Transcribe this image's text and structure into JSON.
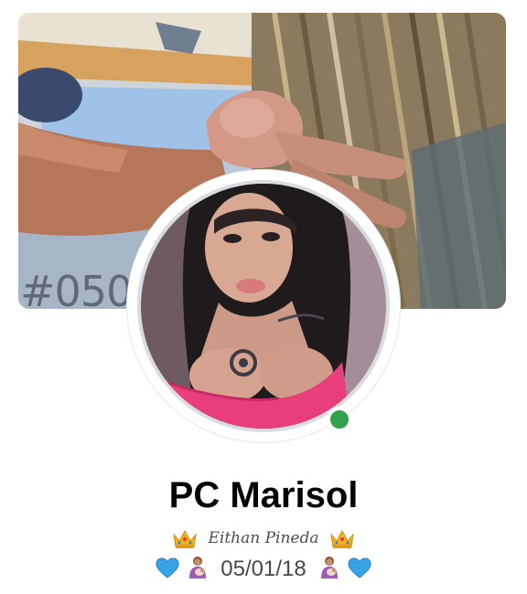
{
  "profile": {
    "cover_watermark": "#050",
    "name": "PC Marisol",
    "online": true,
    "status_color": "#31a24c"
  },
  "bio": {
    "line1_text": "Eithan Pineda",
    "line1_emoji": "crown-icon",
    "line2_text": "05/01/18",
    "line2_emojis": [
      "blue-heart-icon",
      "mother-baby-icon"
    ]
  }
}
